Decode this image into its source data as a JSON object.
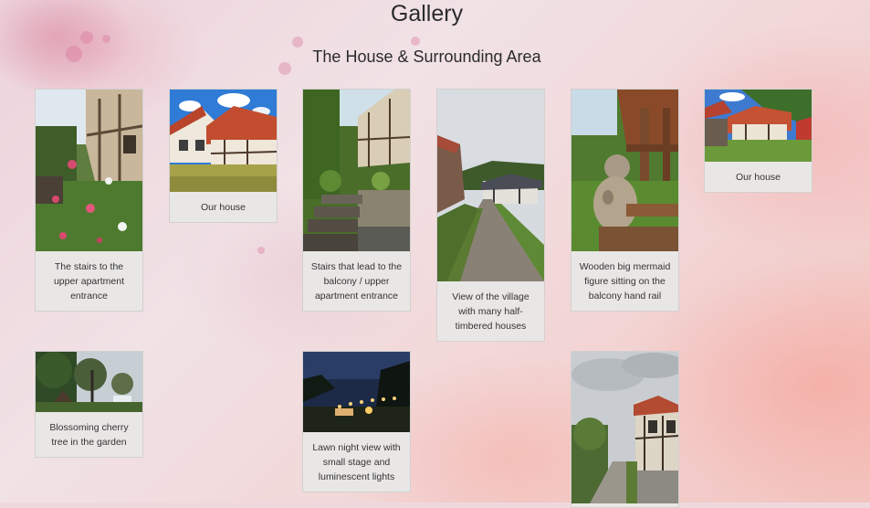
{
  "page": {
    "title": "Gallery",
    "subtitle": "The House & Surrounding Area"
  },
  "gallery": {
    "items": [
      {
        "caption": "The stairs to the upper apartment entrance"
      },
      {
        "caption": "Our house"
      },
      {
        "caption": "Stairs that lead to the balcony / upper apartment entrance"
      },
      {
        "caption": "View of the village with many half-timbered houses"
      },
      {
        "caption": "Wooden big mermaid figure sitting on the balcony hand rail"
      },
      {
        "caption": "Our house"
      },
      {
        "caption": "Blossoming cherry tree in the garden"
      },
      {
        "caption": "Lawn night view with small stage and luminescent lights"
      },
      {
        "caption": ""
      }
    ]
  },
  "colors": {
    "card_background": "#e9e7e6",
    "text": "#2b2b2b"
  }
}
